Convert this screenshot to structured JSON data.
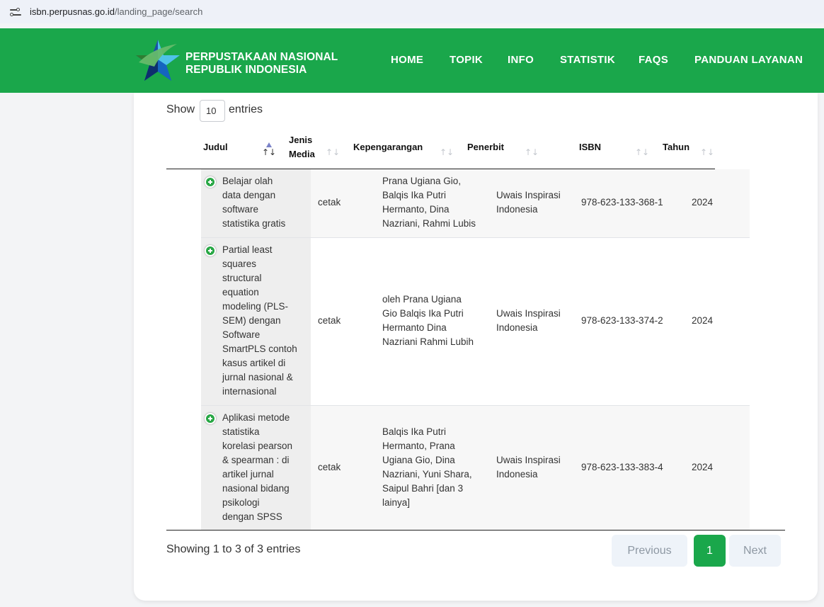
{
  "browser": {
    "url_host": "isbn.perpusnas.go.id",
    "url_path": "/landing_page/search"
  },
  "header": {
    "brand_line1": "PERPUSTAKAAN NASIONAL",
    "brand_line2": "REPUBLIK INDONESIA",
    "nav": [
      "HOME",
      "TOPIK",
      "INFO",
      "STATISTIK",
      "FAQS",
      "PANDUAN LAYANAN"
    ],
    "accent_color": "#1aa74b"
  },
  "length_control": {
    "show_label": "Show",
    "value": "10",
    "entries_label": "entries"
  },
  "table": {
    "columns": [
      "Judul",
      "Jenis",
      "Media",
      "Kepengarangan",
      "Penerbit",
      "ISBN",
      "Tahun"
    ],
    "sorted_column": "Judul",
    "sort_direction": "ascending",
    "rows": [
      {
        "judul": [
          "Belajar olah",
          "data dengan",
          "software",
          "statistika gratis"
        ],
        "jenis_media": "cetak",
        "kepengarangan": [
          "Prana Ugiana Gio,",
          "Balqis Ika Putri",
          "Hermanto, Dina",
          "Nazriani, Rahmi Lubis"
        ],
        "penerbit": [
          "Uwais Inspirasi",
          "Indonesia"
        ],
        "isbn": "978-623-133-368-1",
        "tahun": "2024"
      },
      {
        "judul": [
          "Partial least",
          "squares",
          "structural",
          "equation",
          "modeling (PLS-",
          "SEM) dengan",
          "Software",
          "SmartPLS contoh",
          "kasus artikel di",
          "jurnal nasional &",
          "internasional"
        ],
        "jenis_media": "cetak",
        "kepengarangan": [
          "oleh Prana Ugiana",
          "Gio Balqis Ika Putri",
          "Hermanto Dina",
          "Nazriani Rahmi Lubih"
        ],
        "penerbit": [
          "Uwais Inspirasi",
          "Indonesia"
        ],
        "isbn": "978-623-133-374-2",
        "tahun": "2024"
      },
      {
        "judul": [
          "Aplikasi metode",
          "statistika",
          "korelasi pearson",
          "& spearman : di",
          "artikel jurnal",
          "nasional bidang",
          "psikologi",
          "dengan SPSS"
        ],
        "jenis_media": "cetak",
        "kepengarangan": [
          "Balqis Ika Putri",
          "Hermanto, Prana",
          "Ugiana Gio, Dina",
          "Nazriani, Yuni Shara,",
          "Saipul Bahri [dan 3",
          "lainya]"
        ],
        "penerbit": [
          "Uwais Inspirasi",
          "Indonesia"
        ],
        "isbn": "978-623-133-383-4",
        "tahun": "2024"
      }
    ]
  },
  "footer": {
    "info": "Showing 1 to 3 of 3 entries",
    "previous": "Previous",
    "current_page": "1",
    "next": "Next"
  }
}
